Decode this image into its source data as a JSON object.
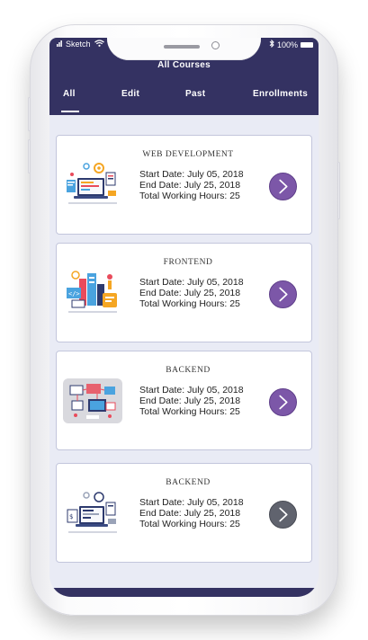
{
  "status_bar": {
    "carrier": "Sketch",
    "battery": "100%"
  },
  "header": {
    "title": "All Courses"
  },
  "tabs": [
    {
      "label": "All"
    },
    {
      "label": "Edit"
    },
    {
      "label": "Past"
    },
    {
      "label": "Enrollments"
    }
  ],
  "labels": {
    "start_prefix": "Start Date: ",
    "end_prefix": "End Date: ",
    "hours_prefix": "Total Working Hours: "
  },
  "courses": [
    {
      "title": "WEB DEVELOPMENT",
      "start_date": "July 05, 2018",
      "end_date": "July 25, 2018",
      "hours": "25",
      "illustration": "web-development-illustration",
      "button_color": "#7c57a8"
    },
    {
      "title": "FRONTEND",
      "start_date": "July 05, 2018",
      "end_date": "July 25, 2018",
      "hours": "25",
      "illustration": "frontend-illustration",
      "button_color": "#7c57a8"
    },
    {
      "title": "BACKEND",
      "start_date": "July 05, 2018",
      "end_date": "July 25, 2018",
      "hours": "25",
      "illustration": "backend-network-illustration",
      "button_color": "#7c57a8"
    },
    {
      "title": "BACKEND",
      "start_date": "July 05, 2018",
      "end_date": "July 25, 2018",
      "hours": "25",
      "illustration": "backend-devices-illustration",
      "button_color": "#60636e"
    }
  ],
  "colors": {
    "header": "#343262",
    "screen_bg": "#e9ebf5",
    "accent_purple": "#7c57a8",
    "button_gray": "#60636e"
  }
}
